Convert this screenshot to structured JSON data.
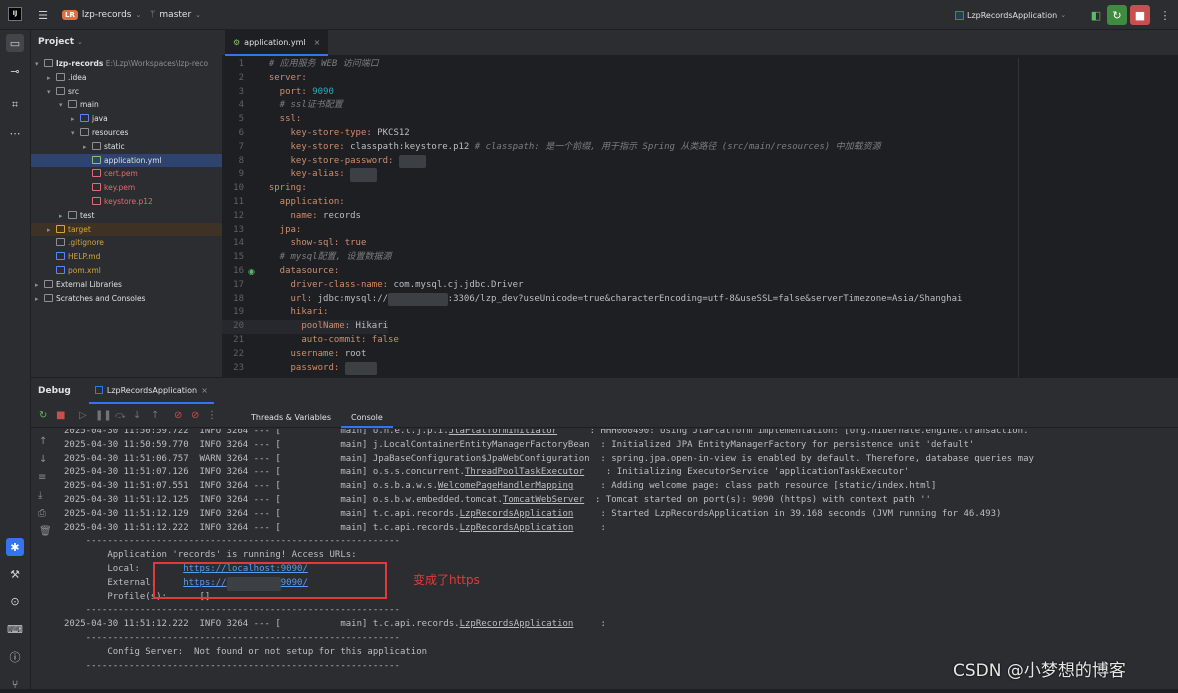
{
  "topbar": {
    "project": "lzp-records",
    "project_badge": "LR",
    "branch": "master",
    "run_config": "LzpRecordsApplication"
  },
  "project_panel": {
    "title": "Project",
    "tree": [
      {
        "label": "lzp-records",
        "suffix": "E:\\Lzp\\Workspaces\\lzp-reco",
        "indent": 0,
        "arrow": "▾",
        "icon": "folder",
        "color": "#dfe1e5",
        "bold": true
      },
      {
        "label": ".idea",
        "indent": 1,
        "arrow": "▸",
        "icon": "folder",
        "color": "#dfe1e5"
      },
      {
        "label": "src",
        "indent": 1,
        "arrow": "▾",
        "icon": "folder",
        "color": "#dfe1e5"
      },
      {
        "label": "main",
        "indent": 2,
        "arrow": "▾",
        "icon": "folder",
        "color": "#dfe1e5"
      },
      {
        "label": "java",
        "indent": 3,
        "arrow": "▸",
        "icon": "folder-blue",
        "color": "#dfe1e5"
      },
      {
        "label": "resources",
        "indent": 3,
        "arrow": "▾",
        "icon": "folder",
        "color": "#dfe1e5"
      },
      {
        "label": "static",
        "indent": 4,
        "arrow": "▸",
        "icon": "folder",
        "color": "#dfe1e5"
      },
      {
        "label": "application.yml",
        "indent": 4,
        "arrow": "",
        "icon": "yml",
        "color": "#dfe1e5",
        "selected": true
      },
      {
        "label": "cert.pem",
        "indent": 4,
        "arrow": "",
        "icon": "file",
        "color": "#e06c75"
      },
      {
        "label": "key.pem",
        "indent": 4,
        "arrow": "",
        "icon": "file",
        "color": "#e06c75"
      },
      {
        "label": "keystore.p12",
        "indent": 4,
        "arrow": "",
        "icon": "file",
        "color": "#e06c75"
      },
      {
        "label": "test",
        "indent": 2,
        "arrow": "▸",
        "icon": "folder",
        "color": "#dfe1e5"
      },
      {
        "label": "target",
        "indent": 1,
        "arrow": "▸",
        "icon": "folder-orange",
        "color": "#d5a53c",
        "highlight": true
      },
      {
        "label": ".gitignore",
        "indent": 1,
        "arrow": "",
        "icon": "git",
        "color": "#d5a53c"
      },
      {
        "label": "HELP.md",
        "indent": 1,
        "arrow": "",
        "icon": "md",
        "color": "#d5a53c"
      },
      {
        "label": "pom.xml",
        "indent": 1,
        "arrow": "",
        "icon": "maven",
        "color": "#d5a53c"
      },
      {
        "label": "External Libraries",
        "indent": 0,
        "arrow": "▸",
        "icon": "lib",
        "color": "#dfe1e5"
      },
      {
        "label": "Scratches and Consoles",
        "indent": 0,
        "arrow": "▸",
        "icon": "scratch",
        "color": "#dfe1e5"
      }
    ]
  },
  "editor": {
    "tab": "application.yml",
    "lines": [
      [
        {
          "t": "  # 应用服务 WEB 访问端口",
          "c": "c"
        }
      ],
      [
        {
          "t": "  server:",
          "c": "k"
        }
      ],
      [
        {
          "t": "    port: ",
          "c": "k"
        },
        {
          "t": "9090",
          "c": "n"
        }
      ],
      [
        {
          "t": "    # ssl证书配置",
          "c": "c"
        }
      ],
      [
        {
          "t": "    ssl:",
          "c": "k"
        }
      ],
      [
        {
          "t": "      key-store-type: ",
          "c": "k"
        },
        {
          "t": "PKCS12",
          "c": "v"
        }
      ],
      [
        {
          "t": "      key-store: ",
          "c": "k"
        },
        {
          "t": "classpath:keystore.p12 ",
          "c": "v"
        },
        {
          "t": "# classpath: 是一个前缀, 用于指示 Spring 从类路径 (src/main/resources) 中加载资源",
          "c": "c"
        }
      ],
      [
        {
          "t": "      key-store-password: ",
          "c": "k"
        },
        {
          "t": "■■■■■",
          "c": "blur"
        }
      ],
      [
        {
          "t": "      key-alias: ",
          "c": "k"
        },
        {
          "t": "■■■■■",
          "c": "blur"
        }
      ],
      [
        {
          "t": "  spring:",
          "c": "k"
        }
      ],
      [
        {
          "t": "    application:",
          "c": "k"
        }
      ],
      [
        {
          "t": "      name: ",
          "c": "k"
        },
        {
          "t": "records",
          "c": "v"
        }
      ],
      [
        {
          "t": "    jpa:",
          "c": "k"
        }
      ],
      [
        {
          "t": "      show-sql: ",
          "c": "k"
        },
        {
          "t": "true",
          "c": "b"
        }
      ],
      [
        {
          "t": "    # mysql配置, 设置数据源",
          "c": "c"
        }
      ],
      [
        {
          "t": "    datasource:",
          "c": "k"
        }
      ],
      [
        {
          "t": "      driver-class-name: ",
          "c": "k"
        },
        {
          "t": "com.mysql.cj.jdbc.Driver",
          "c": "v"
        }
      ],
      [
        {
          "t": "      url: ",
          "c": "k"
        },
        {
          "t": "jdbc:mysql://",
          "c": "v"
        },
        {
          "t": "■■■■■■■■■■■",
          "c": "blur"
        },
        {
          "t": ":3306/lzp_dev?useUnicode=true&characterEncoding=utf-8&useSSL=false&serverTimezone=Asia/Shanghai",
          "c": "v"
        }
      ],
      [
        {
          "t": "      hikari:",
          "c": "k"
        }
      ],
      [
        {
          "t": "        poolName: ",
          "c": "k"
        },
        {
          "t": "Hikari",
          "c": "v"
        }
      ],
      [
        {
          "t": "        auto-commit: ",
          "c": "k"
        },
        {
          "t": "false",
          "c": "b"
        }
      ],
      [
        {
          "t": "      username: ",
          "c": "k"
        },
        {
          "t": "root",
          "c": "v"
        }
      ],
      [
        {
          "t": "      password: ",
          "c": "k"
        },
        {
          "t": "■■■■■■",
          "c": "blur"
        }
      ]
    ]
  },
  "debug": {
    "title": "Debug",
    "session_tab": "LzpRecordsApplication",
    "subtabs": [
      "Threads & Variables",
      "Console"
    ],
    "active_subtab": "Console",
    "log": [
      [
        {
          "t": "2025-04-30 11:50:59.722  INFO 3264 --- [           main] o.h.e.t.j.p.i.",
          "c": "v"
        },
        {
          "t": "JtaPlatformInitiator",
          "c": "u"
        },
        {
          "t": "      : HHH000490: Using JtaPlatform implementation: [org.hibernate.engine.transaction.",
          "c": "v"
        }
      ],
      [
        {
          "t": "2025-04-30 11:50:59.770  INFO 3264 --- [           main] j.LocalContainerEntityManagerFactoryBean  : Initialized JPA EntityManagerFactory for persistence unit 'default'",
          "c": "v"
        }
      ],
      [
        {
          "t": "2025-04-30 11:51:06.757  WARN 3264 --- [           main] JpaBaseConfiguration$JpaWebConfiguration  : spring.jpa.open-in-view is enabled by default. Therefore, database queries may",
          "c": "v"
        }
      ],
      [
        {
          "t": "2025-04-30 11:51:07.126  INFO 3264 --- [           main] o.s.s.concurrent.",
          "c": "v"
        },
        {
          "t": "ThreadPoolTaskExecutor",
          "c": "u"
        },
        {
          "t": "    : Initializing ExecutorService 'applicationTaskExecutor'",
          "c": "v"
        }
      ],
      [
        {
          "t": "2025-04-30 11:51:07.551  INFO 3264 --- [           main] o.s.b.a.w.s.",
          "c": "v"
        },
        {
          "t": "WelcomePageHandlerMapping",
          "c": "u"
        },
        {
          "t": "     : Adding welcome page: class path resource [static/index.html]",
          "c": "v"
        }
      ],
      [
        {
          "t": "2025-04-30 11:51:12.125  INFO 3264 --- [           main] o.s.b.w.embedded.tomcat.",
          "c": "v"
        },
        {
          "t": "TomcatWebServer",
          "c": "u"
        },
        {
          "t": "  : Tomcat started on port(s): 9090 (https) with context path ''",
          "c": "v"
        }
      ],
      [
        {
          "t": "2025-04-30 11:51:12.129  INFO 3264 --- [           main] t.c.api.records.",
          "c": "v"
        },
        {
          "t": "LzpRecordsApplication",
          "c": "u"
        },
        {
          "t": "     : Started LzpRecordsApplication in 39.168 seconds (JVM running for 46.493)",
          "c": "v"
        }
      ],
      [
        {
          "t": "2025-04-30 11:51:12.222  INFO 3264 --- [           main] t.c.api.records.",
          "c": "v"
        },
        {
          "t": "LzpRecordsApplication",
          "c": "u"
        },
        {
          "t": "     :",
          "c": "v"
        }
      ],
      [
        {
          "t": "    ----------------------------------------------------------",
          "c": "v"
        }
      ],
      [
        {
          "t": "        Application 'records' is running! Access URLs:",
          "c": "v"
        }
      ],
      [
        {
          "t": "        Local:        ",
          "c": "v"
        },
        {
          "t": "https://localhost:9090/",
          "c": "link"
        }
      ],
      [
        {
          "t": "        External:     ",
          "c": "v"
        },
        {
          "t": "https://",
          "c": "link"
        },
        {
          "t": "■■■■■■■■■■",
          "c": "blur"
        },
        {
          "t": "9090/",
          "c": "link"
        }
      ],
      [
        {
          "t": "        Profile(s):      []",
          "c": "v"
        }
      ],
      [
        {
          "t": "    ----------------------------------------------------------",
          "c": "v"
        }
      ],
      [
        {
          "t": "2025-04-30 11:51:12.222  INFO 3264 --- [           main] t.c.api.records.",
          "c": "v"
        },
        {
          "t": "LzpRecordsApplication",
          "c": "u"
        },
        {
          "t": "     :",
          "c": "v"
        }
      ],
      [
        {
          "t": "    ----------------------------------------------------------",
          "c": "v"
        }
      ],
      [
        {
          "t": "        Config Server:  Not found or not setup for this application",
          "c": "v"
        }
      ],
      [
        {
          "t": "    ----------------------------------------------------------",
          "c": "v"
        }
      ]
    ]
  },
  "annotation": {
    "text": "变成了https",
    "color": "#e03b3b"
  },
  "watermark": "CSDN @小梦想的博客"
}
